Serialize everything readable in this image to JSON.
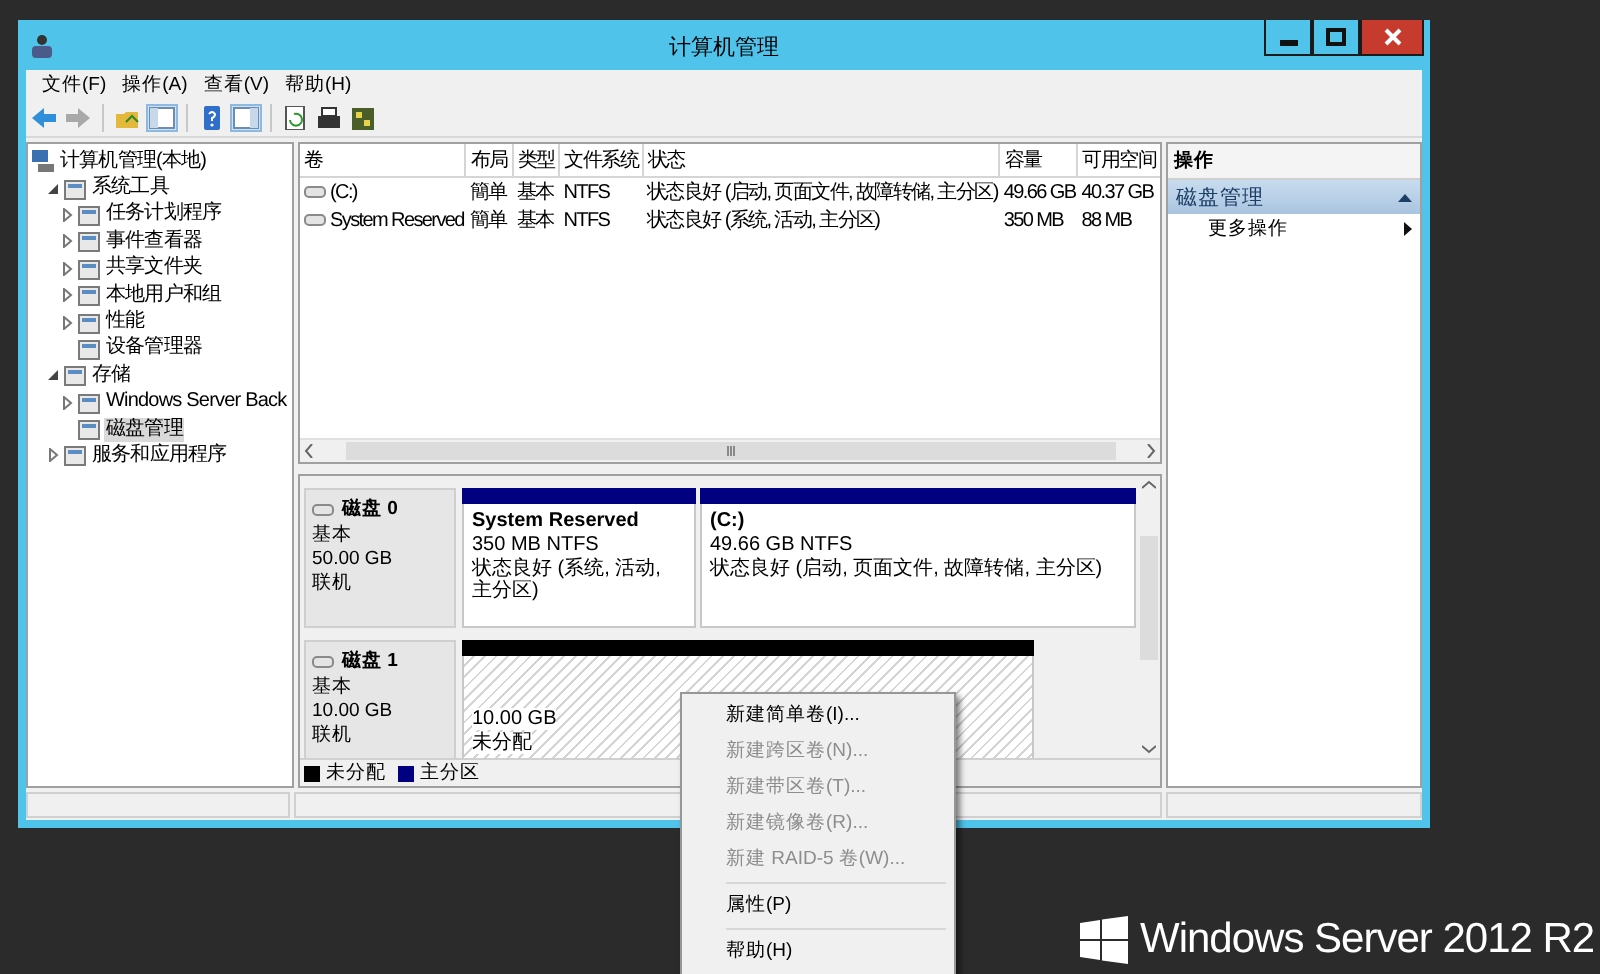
{
  "window": {
    "title": "计算机管理"
  },
  "menu": [
    "文件(F)",
    "操作(A)",
    "查看(V)",
    "帮助(H)"
  ],
  "tree": [
    {
      "label": "计算机管理(本地)",
      "selected": false,
      "children": [
        {
          "label": "系统工具",
          "selected": false,
          "expanded": true,
          "children": [
            {
              "label": "任务计划程序",
              "selected": false,
              "expanded": false
            },
            {
              "label": "事件查看器",
              "selected": false,
              "expanded": false
            },
            {
              "label": "共享文件夹",
              "selected": false,
              "expanded": false
            },
            {
              "label": "本地用户和组",
              "selected": false,
              "expanded": false
            },
            {
              "label": "性能",
              "selected": false,
              "expanded": false
            },
            {
              "label": "设备管理器",
              "selected": false
            }
          ]
        },
        {
          "label": "存储",
          "selected": false,
          "expanded": true,
          "children": [
            {
              "label": "Windows Server Back",
              "selected": false,
              "expanded": false
            },
            {
              "label": "磁盘管理",
              "selected": true
            }
          ]
        },
        {
          "label": "服务和应用程序",
          "selected": false,
          "expanded": false
        }
      ]
    }
  ],
  "volumes": {
    "columns": [
      "卷",
      "布局",
      "类型",
      "文件系统",
      "状态",
      "容量",
      "可用空间"
    ],
    "rows": [
      [
        "(C:)",
        "簡单",
        "基本",
        "NTFS",
        "状态良好 (启动, 页面文件, 故障转储, 主分区)",
        "49.66 GB",
        "40.37 GB"
      ],
      [
        "System Reserved",
        "簡单",
        "基本",
        "NTFS",
        "状态良好 (系统, 活动, 主分区)",
        "350 MB",
        "88 MB"
      ]
    ]
  },
  "disks": [
    {
      "name": "磁盘 0",
      "type": "基本",
      "size": "50.00 GB",
      "status": "联机",
      "partitions": [
        {
          "kind": "primary",
          "name": "System Reserved",
          "size": "350 MB NTFS",
          "status": "状态良好 (系统, 活动, 主分区)"
        },
        {
          "kind": "primary",
          "name": "(C:)",
          "size": "49.66 GB NTFS",
          "status": "状态良好 (启动, 页面文件, 故障转储, 主分区)"
        }
      ]
    },
    {
      "name": "磁盘 1",
      "type": "基本",
      "size": "10.00 GB",
      "status": "联机",
      "partitions": [
        {
          "kind": "unallocated",
          "size": "10.00 GB",
          "status": "未分配"
        }
      ]
    }
  ],
  "legend": [
    {
      "label": "未分配",
      "color": "#000000"
    },
    {
      "label": "主分区",
      "color": "#000080"
    }
  ],
  "actions": {
    "header": "操作",
    "section": {
      "title": "磁盘管理",
      "expanded": true
    },
    "items": [
      "更多操作"
    ]
  },
  "context_menu": [
    {
      "kind": "item",
      "label": "新建简单卷(I)...",
      "disabled": false
    },
    {
      "kind": "item",
      "label": "新建跨区卷(N)...",
      "disabled": true
    },
    {
      "kind": "item",
      "label": "新建带区卷(T)...",
      "disabled": true
    },
    {
      "kind": "item",
      "label": "新建镜像卷(R)...",
      "disabled": true
    },
    {
      "kind": "item",
      "label": "新建 RAID-5 卷(W)...",
      "disabled": true
    },
    {
      "kind": "separator"
    },
    {
      "kind": "item",
      "label": "属性(P)",
      "disabled": false
    },
    {
      "kind": "separator"
    },
    {
      "kind": "item",
      "label": "帮助(H)",
      "disabled": false
    }
  ],
  "branding": "Windows Server 2012 R2"
}
